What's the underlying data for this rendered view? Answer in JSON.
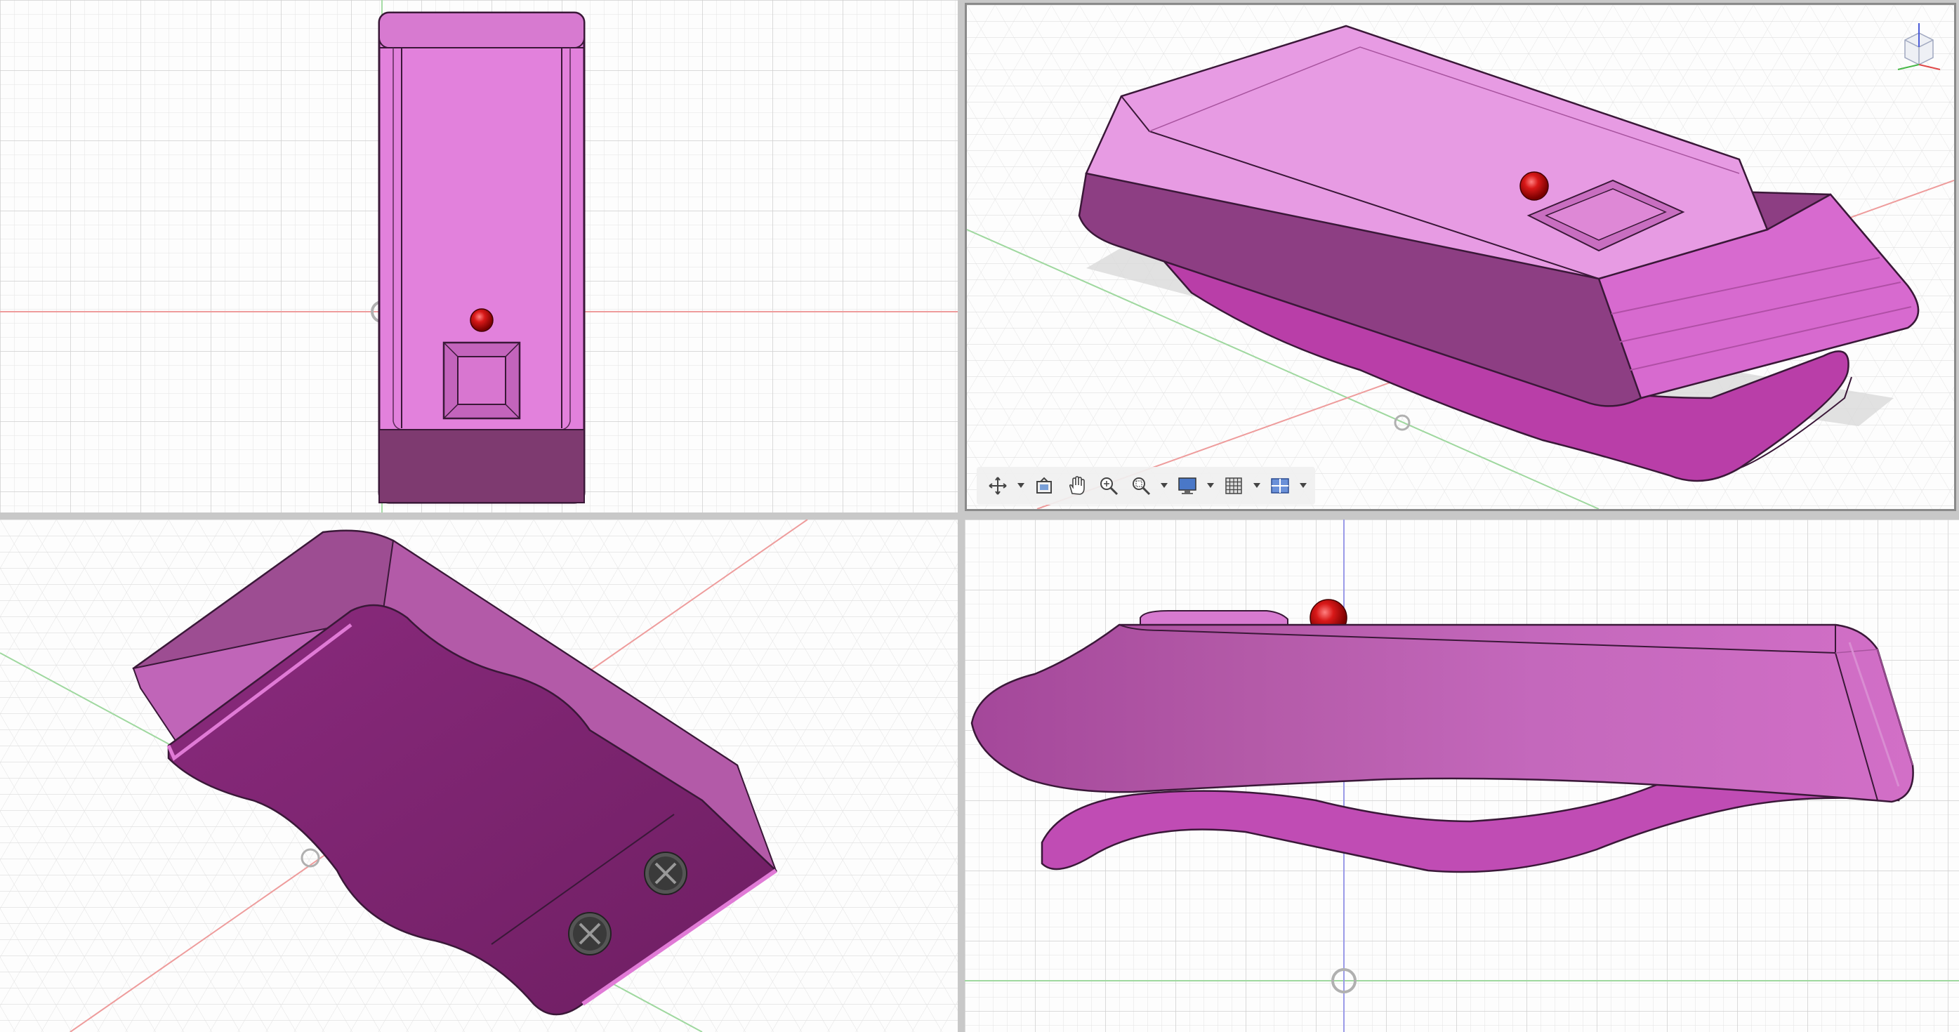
{
  "app": {
    "layout": "four-viewport",
    "background_color": "#fdfdfd",
    "grid_color": "#d9d9d9",
    "x_axis_color": "#e8a0a0",
    "y_axis_color": "#a0d8a0",
    "z_axis_color": "#9a9ae8",
    "body_color": "#e07fd8",
    "body_dark_color": "#7d2f6e",
    "led_color": "#d01010"
  },
  "viewports": [
    {
      "id": "top-left",
      "view": "top"
    },
    {
      "id": "top-right",
      "view": "perspective",
      "active": true
    },
    {
      "id": "bottom-left",
      "view": "bottom-isometric"
    },
    {
      "id": "bottom-right",
      "view": "side"
    }
  ],
  "navigation_bar": {
    "tools": [
      {
        "name": "orbit",
        "icon": "orbit-icon",
        "has_menu": true
      },
      {
        "name": "look-at",
        "icon": "look-at-icon",
        "has_menu": false
      },
      {
        "name": "pan",
        "icon": "pan-hand-icon",
        "has_menu": false
      },
      {
        "name": "zoom",
        "icon": "zoom-icon",
        "has_menu": false
      },
      {
        "name": "fit",
        "icon": "zoom-window-icon",
        "has_menu": true
      },
      {
        "name": "display-settings",
        "icon": "display-monitor-icon",
        "has_menu": true
      },
      {
        "name": "grid-and-snaps",
        "icon": "grid-icon",
        "has_menu": true
      },
      {
        "name": "viewports",
        "icon": "viewports-icon",
        "has_menu": true
      }
    ]
  },
  "viewcube": {
    "icon": "viewcube-icon"
  }
}
